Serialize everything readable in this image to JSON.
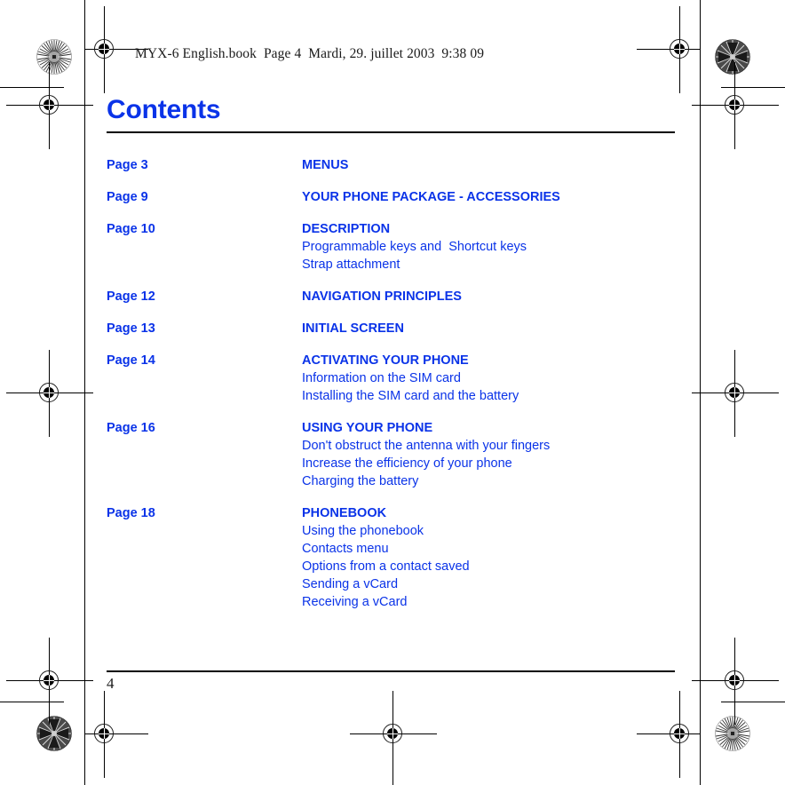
{
  "header": {
    "meta_line": "MYX-6 English.book  Page 4  Mardi, 29. juillet 2003  9:38 09"
  },
  "page_title": "Contents",
  "colors": {
    "accent_blue": "#0a33e8",
    "rule_black": "#000000",
    "header_text": "#1a1a1a"
  },
  "toc": {
    "entries": [
      {
        "page": "Page 3",
        "chapter": "MENUS",
        "subs": []
      },
      {
        "page": "Page 9",
        "chapter": "YOUR PHONE PACKAGE - ACCESSORIES",
        "subs": []
      },
      {
        "page": "Page 10",
        "chapter": "DESCRIPTION",
        "subs": [
          "Programmable keys and  Shortcut keys",
          "Strap attachment"
        ]
      },
      {
        "page": "Page 12",
        "chapter": "NAVIGATION PRINCIPLES",
        "subs": []
      },
      {
        "page": "Page 13",
        "chapter": "INITIAL SCREEN",
        "subs": []
      },
      {
        "page": "Page 14",
        "chapter": "ACTIVATING YOUR PHONE",
        "subs": [
          "Information on the SIM card",
          "Installing the SIM card and the battery"
        ]
      },
      {
        "page": "Page 16",
        "chapter": "USING YOUR PHONE",
        "subs": [
          "Don't obstruct the antenna with your fingers",
          "Increase the efficiency of your phone",
          "Charging the battery"
        ]
      },
      {
        "page": "Page 18",
        "chapter": "PHONEBOOK",
        "subs": [
          "Using the phonebook",
          "Contacts menu",
          "Options from a contact saved",
          "Sending a vCard",
          "Receiving a vCard"
        ]
      }
    ]
  },
  "footer": {
    "page_number": "4"
  },
  "print_marks": {
    "registration_icon": "registration-crosshair-icon",
    "rosette_light_icon": "star-target-light-icon",
    "rosette_dark_icon": "star-target-dark-icon"
  }
}
